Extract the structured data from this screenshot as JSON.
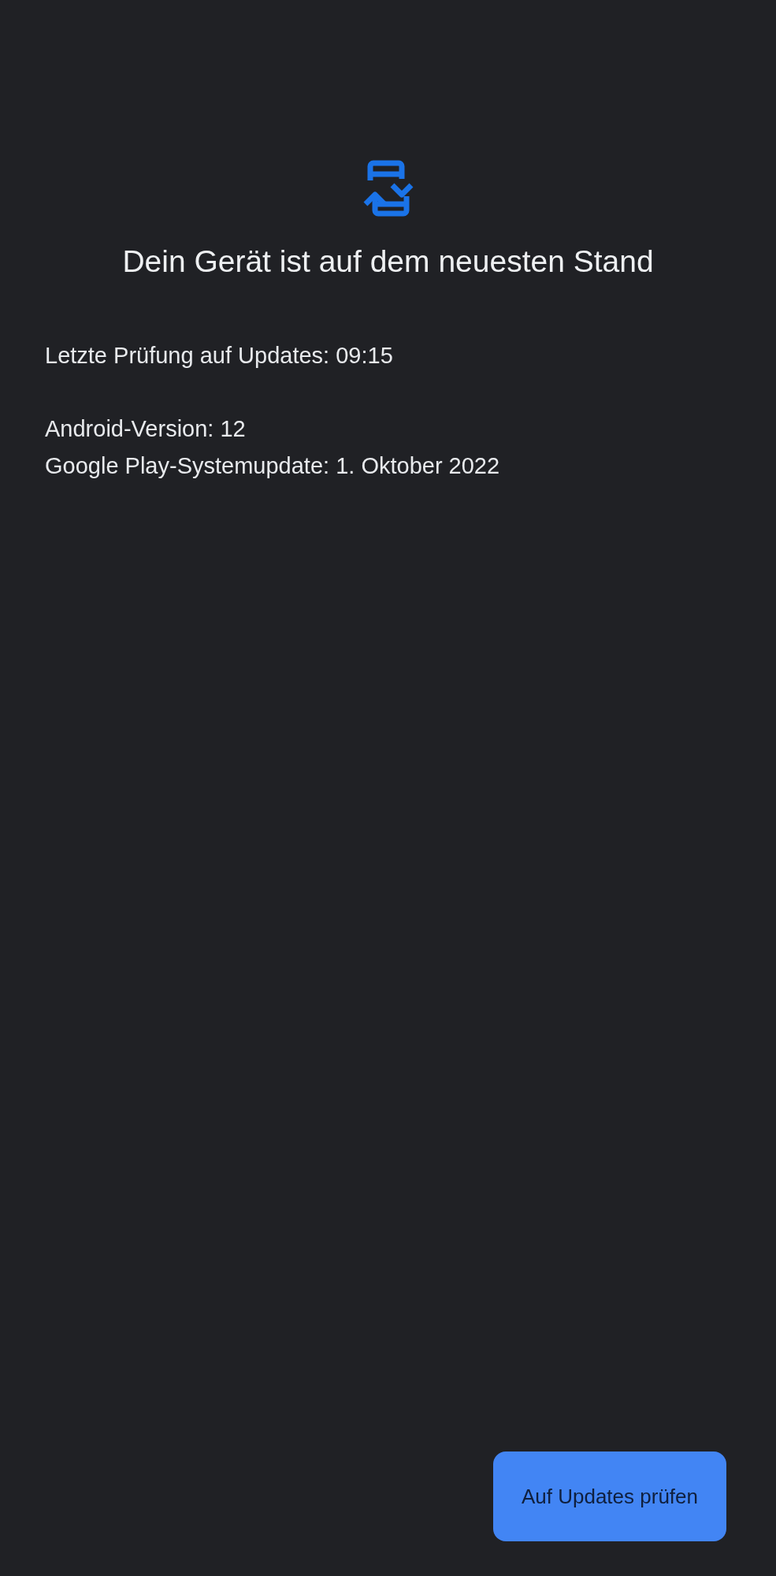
{
  "title": "Dein Gerät ist auf dem neuesten Stand",
  "last_check": "Letzte Prüfung auf Updates: 09:15",
  "info_lines": [
    "Android-Version: 12",
    "Google Play-Systemupdate: 1. Oktober 2022"
  ],
  "button": "Auf Updates prüfen"
}
